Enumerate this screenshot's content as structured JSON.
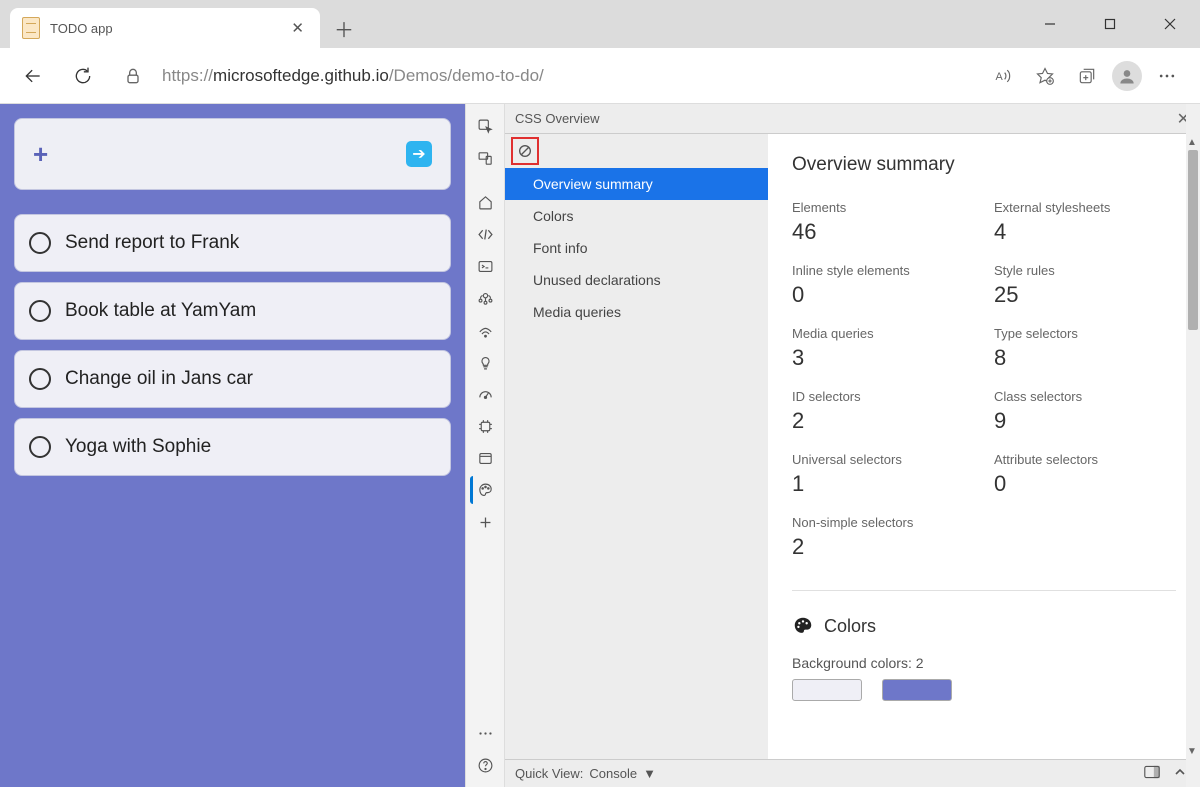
{
  "tab": {
    "title": "TODO app"
  },
  "address": {
    "prefix": "https://",
    "host": "microsoftedge.github.io",
    "path": "/Demos/demo-to-do/"
  },
  "todo": {
    "items": [
      "Send report to Frank",
      "Book table at YamYam",
      "Change oil in Jans car",
      "Yoga with Sophie"
    ]
  },
  "panel": {
    "title": "CSS Overview",
    "nav": [
      "Overview summary",
      "Colors",
      "Font info",
      "Unused declarations",
      "Media queries"
    ],
    "selected": 0
  },
  "overview": {
    "heading": "Overview summary",
    "stats": [
      {
        "label": "Elements",
        "value": "46"
      },
      {
        "label": "External stylesheets",
        "value": "4"
      },
      {
        "label": "Inline style elements",
        "value": "0"
      },
      {
        "label": "Style rules",
        "value": "25"
      },
      {
        "label": "Media queries",
        "value": "3"
      },
      {
        "label": "Type selectors",
        "value": "8"
      },
      {
        "label": "ID selectors",
        "value": "2"
      },
      {
        "label": "Class selectors",
        "value": "9"
      },
      {
        "label": "Universal selectors",
        "value": "1"
      },
      {
        "label": "Attribute selectors",
        "value": "0"
      },
      {
        "label": "Non-simple selectors",
        "value": "2"
      }
    ]
  },
  "colors": {
    "heading": "Colors",
    "bg_label": "Background colors: 2",
    "swatches": [
      "#efeff6",
      "#6e77c9"
    ]
  },
  "quickview": {
    "label": "Quick View:",
    "value": "Console"
  }
}
